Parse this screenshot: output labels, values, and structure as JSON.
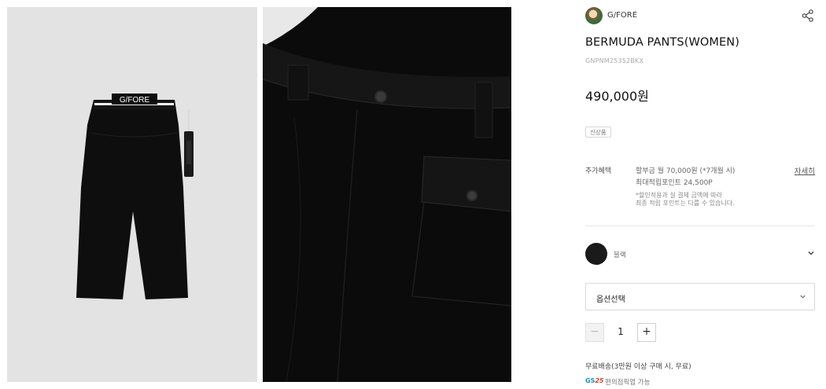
{
  "gallery": {
    "image1_brand_text": "G/FORE"
  },
  "brand": {
    "name": "G/FORE"
  },
  "product": {
    "title": "BERMUDA PANTS(WOMEN)",
    "code": "GNPNM25352BKX",
    "price": "490,000원",
    "badge": "신상품"
  },
  "benefits": {
    "label": "추가혜택",
    "line1": "할부금 월 70,000원 (*7개월 시)",
    "line2": "최대적립포인트 24,500P",
    "note1": "*할인적용과 실 결제 금액에 따라",
    "note2": "최종 적립 포인트는 다를 수 있습니다.",
    "more": "자세히"
  },
  "color": {
    "name": "블랙",
    "swatch": "#1a1a1a"
  },
  "option": {
    "label": "옵션선택"
  },
  "quantity": {
    "minus": "−",
    "value": "1",
    "plus": "+"
  },
  "shipping": {
    "text": "무료배송(3만원 이상 구매 시, 무료)",
    "pickup_logo_gs": "GS",
    "pickup_logo_25": "25",
    "pickup_text": "편의점픽업 가능"
  },
  "icons": {
    "share": "share-icon",
    "chevron": "chevron-down-icon"
  }
}
